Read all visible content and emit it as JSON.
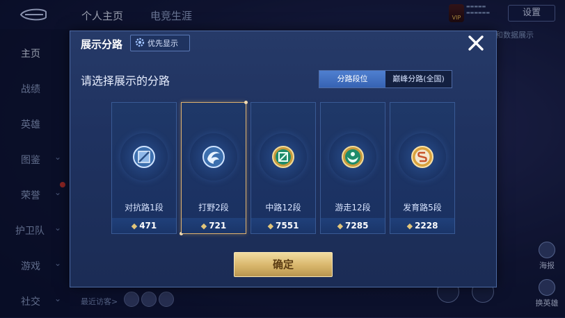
{
  "header": {
    "tabs": [
      "个人主页",
      "电竞生涯"
    ],
    "settings_label": "设置",
    "vip_label": "VIP"
  },
  "sidebar": {
    "items": [
      {
        "label": "主页"
      },
      {
        "label": "战绩"
      },
      {
        "label": "英雄"
      },
      {
        "label": "图鉴"
      },
      {
        "label": "荣誉"
      },
      {
        "label": "护卫队"
      },
      {
        "label": "游戏"
      },
      {
        "label": "社交"
      }
    ]
  },
  "background": {
    "data_show_text": "和数据展示",
    "visitors_label": "最近访客>",
    "right_buttons": [
      "海报",
      "换英雄"
    ]
  },
  "modal": {
    "title": "展示分路",
    "priority_label": "优先显示",
    "subtitle": "请选择展示的分路",
    "segment": {
      "options": [
        "分路段位",
        "巅峰分路(全国)"
      ],
      "selected": "分路段位"
    },
    "lanes": [
      {
        "name": "对抗路1段",
        "score": "471",
        "icon": "clash-lane-emblem",
        "color": "#9cc3ee"
      },
      {
        "name": "打野2段",
        "score": "721",
        "icon": "jungle-emblem",
        "color": "#a8c9ef",
        "selected": true
      },
      {
        "name": "中路12段",
        "score": "7551",
        "icon": "mid-lane-emblem",
        "color": "#3fc79a"
      },
      {
        "name": "游走12段",
        "score": "7285",
        "icon": "roam-emblem",
        "color": "#3fc79a"
      },
      {
        "name": "发育路5段",
        "score": "2228",
        "icon": "farm-lane-emblem",
        "color": "#e0a94a"
      }
    ],
    "confirm_label": "确定"
  },
  "colors": {
    "accent_gold": "#e0b36f",
    "segment_active": "#3f6fc0",
    "modal_bg": "#213463"
  }
}
